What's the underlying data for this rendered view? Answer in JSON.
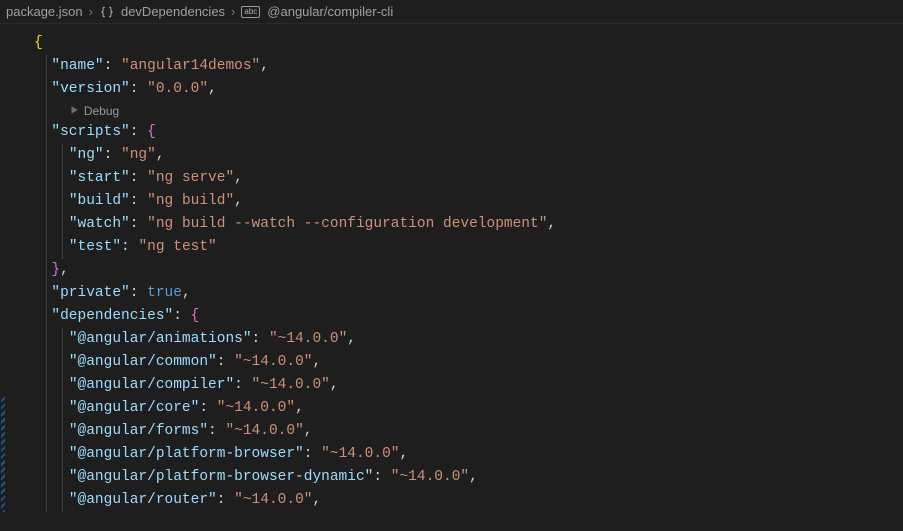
{
  "breadcrumb": {
    "file": "package.json",
    "path1": "devDependencies",
    "path2": "@angular/compiler-cli"
  },
  "codelens": {
    "debug": "Debug"
  },
  "json": {
    "name_key": "\"name\"",
    "name_val": "\"angular14demos\"",
    "version_key": "\"version\"",
    "version_val": "\"0.0.0\"",
    "scripts_key": "\"scripts\"",
    "scripts": {
      "ng_key": "\"ng\"",
      "ng_val": "\"ng\"",
      "start_key": "\"start\"",
      "start_val": "\"ng serve\"",
      "build_key": "\"build\"",
      "build_val": "\"ng build\"",
      "watch_key": "\"watch\"",
      "watch_val": "\"ng build --watch --configuration development\"",
      "test_key": "\"test\"",
      "test_val": "\"ng test\""
    },
    "private_key": "\"private\"",
    "private_val": "true",
    "dependencies_key": "\"dependencies\"",
    "deps": {
      "anim_key": "\"@angular/animations\"",
      "anim_val": "\"~14.0.0\"",
      "common_key": "\"@angular/common\"",
      "common_val": "\"~14.0.0\"",
      "compiler_key": "\"@angular/compiler\"",
      "compiler_val": "\"~14.0.0\"",
      "core_key": "\"@angular/core\"",
      "core_val": "\"~14.0.0\"",
      "forms_key": "\"@angular/forms\"",
      "forms_val": "\"~14.0.0\"",
      "pb_key": "\"@angular/platform-browser\"",
      "pb_val": "\"~14.0.0\"",
      "pbd_key": "\"@angular/platform-browser-dynamic\"",
      "pbd_val": "\"~14.0.0\"",
      "router_key": "\"@angular/router\"",
      "router_val": "\"~14.0.0\""
    }
  }
}
